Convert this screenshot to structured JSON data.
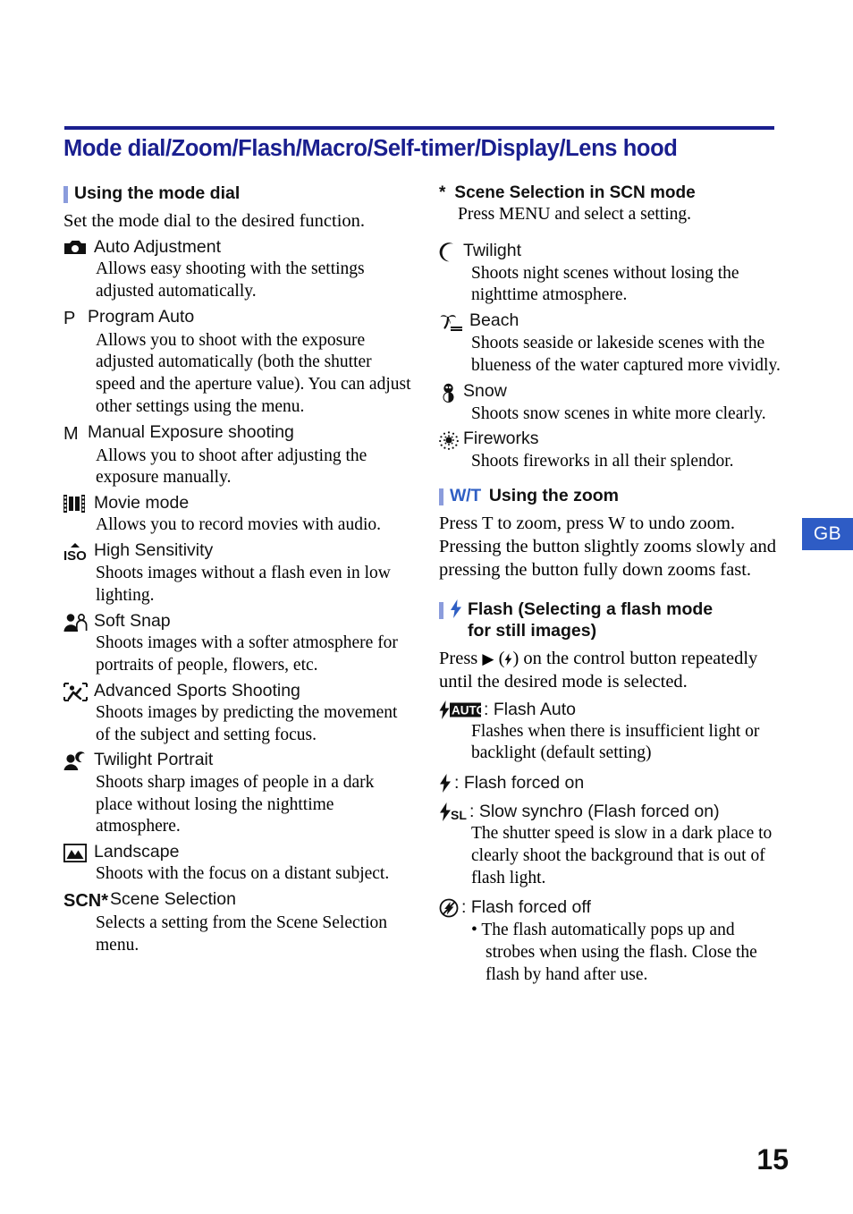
{
  "page": {
    "title": "Mode dial/Zoom/Flash/Macro/Self-timer/Display/Lens hood",
    "number": "15",
    "language_tab": "GB",
    "accent_blue": "#1a1f8f",
    "tab_blue": "#2e5cc5",
    "heading_bar_blue": "#8b9cdc"
  },
  "left_column": {
    "heading": "Using the mode dial",
    "lead": "Set the mode dial to the desired function.",
    "modes": [
      {
        "icon": "camera-icon",
        "name": "Auto Adjustment",
        "desc": "Allows easy shooting with the settings adjusted automatically."
      },
      {
        "icon": "letter-p-icon",
        "name": "Program Auto",
        "desc": "Allows you to shoot with the exposure adjusted automatically (both the shutter speed and the aperture value). You can adjust other settings using the menu."
      },
      {
        "icon": "letter-m-icon",
        "name": "Manual Exposure shooting",
        "desc": "Allows you to shoot after adjusting the exposure manually."
      },
      {
        "icon": "film-strip-icon",
        "name": "Movie mode",
        "desc": "Allows you to record movies with audio."
      },
      {
        "icon": "iso-icon",
        "name": "High Sensitivity",
        "desc": "Shoots images without a flash even in low lighting."
      },
      {
        "icon": "soft-snap-icon",
        "name": "Soft Snap",
        "desc": "Shoots images with a softer atmosphere for portraits of people, flowers, etc."
      },
      {
        "icon": "sports-icon",
        "name": "Advanced Sports Shooting",
        "desc": "Shoots images by predicting the movement of the subject and setting focus."
      },
      {
        "icon": "twilight-portrait-icon",
        "name": "Twilight Portrait",
        "desc": "Shoots sharp images of people in a dark place without losing the nighttime atmosphere."
      },
      {
        "icon": "landscape-icon",
        "name": "Landscape",
        "desc": "Shoots with the focus on a distant subject."
      },
      {
        "icon": "scn-icon",
        "name": "Scene Selection",
        "desc": "Selects a setting from the Scene Selection menu."
      }
    ]
  },
  "right_column": {
    "scene_section": {
      "star": "*",
      "heading": "Scene Selection in SCN mode",
      "lead": "Press MENU and select a setting.",
      "scenes": [
        {
          "icon": "moon-icon",
          "name": "Twilight",
          "desc": "Shoots night scenes without losing the nighttime atmosphere."
        },
        {
          "icon": "palm-tree-icon",
          "name": "Beach",
          "desc": "Shoots seaside or lakeside scenes with the blueness of the water captured more vividly."
        },
        {
          "icon": "snowman-icon",
          "name": "Snow",
          "desc": "Shoots snow scenes in white more clearly."
        },
        {
          "icon": "fireworks-icon",
          "name": "Fireworks",
          "desc": "Shoots fireworks in all their splendor."
        }
      ]
    },
    "zoom_section": {
      "prefix": "W/T",
      "heading": "Using the zoom",
      "body": "Press T to zoom, press W to undo zoom. Pressing the button slightly zooms slowly and pressing the button fully down zooms fast."
    },
    "flash_section": {
      "heading_line1": "Flash (Selecting a flash mode",
      "heading_line2": "for still images)",
      "body_part1": "Press ",
      "body_triangle": "▶",
      "body_part2": " (",
      "body_bolt": "⚡",
      "body_part3": ") on the control button repeatedly until the desired mode is selected.",
      "modes": [
        {
          "icon": "flash-auto-icon",
          "label": ": Flash Auto",
          "desc": "Flashes when there is insufficient light or backlight (default setting)"
        },
        {
          "icon": "flash-on-icon",
          "label": ": Flash forced on",
          "desc": ""
        },
        {
          "icon": "flash-slow-synchro-icon",
          "label": ": Slow synchro (Flash forced on)",
          "desc": "The shutter speed is slow in a dark place to clearly shoot the background that is out of flash light."
        },
        {
          "icon": "flash-off-icon",
          "label": ": Flash forced off",
          "desc": ""
        }
      ],
      "note": "• The flash automatically pops up and strobes when using the flash. Close the flash by hand after use."
    }
  }
}
